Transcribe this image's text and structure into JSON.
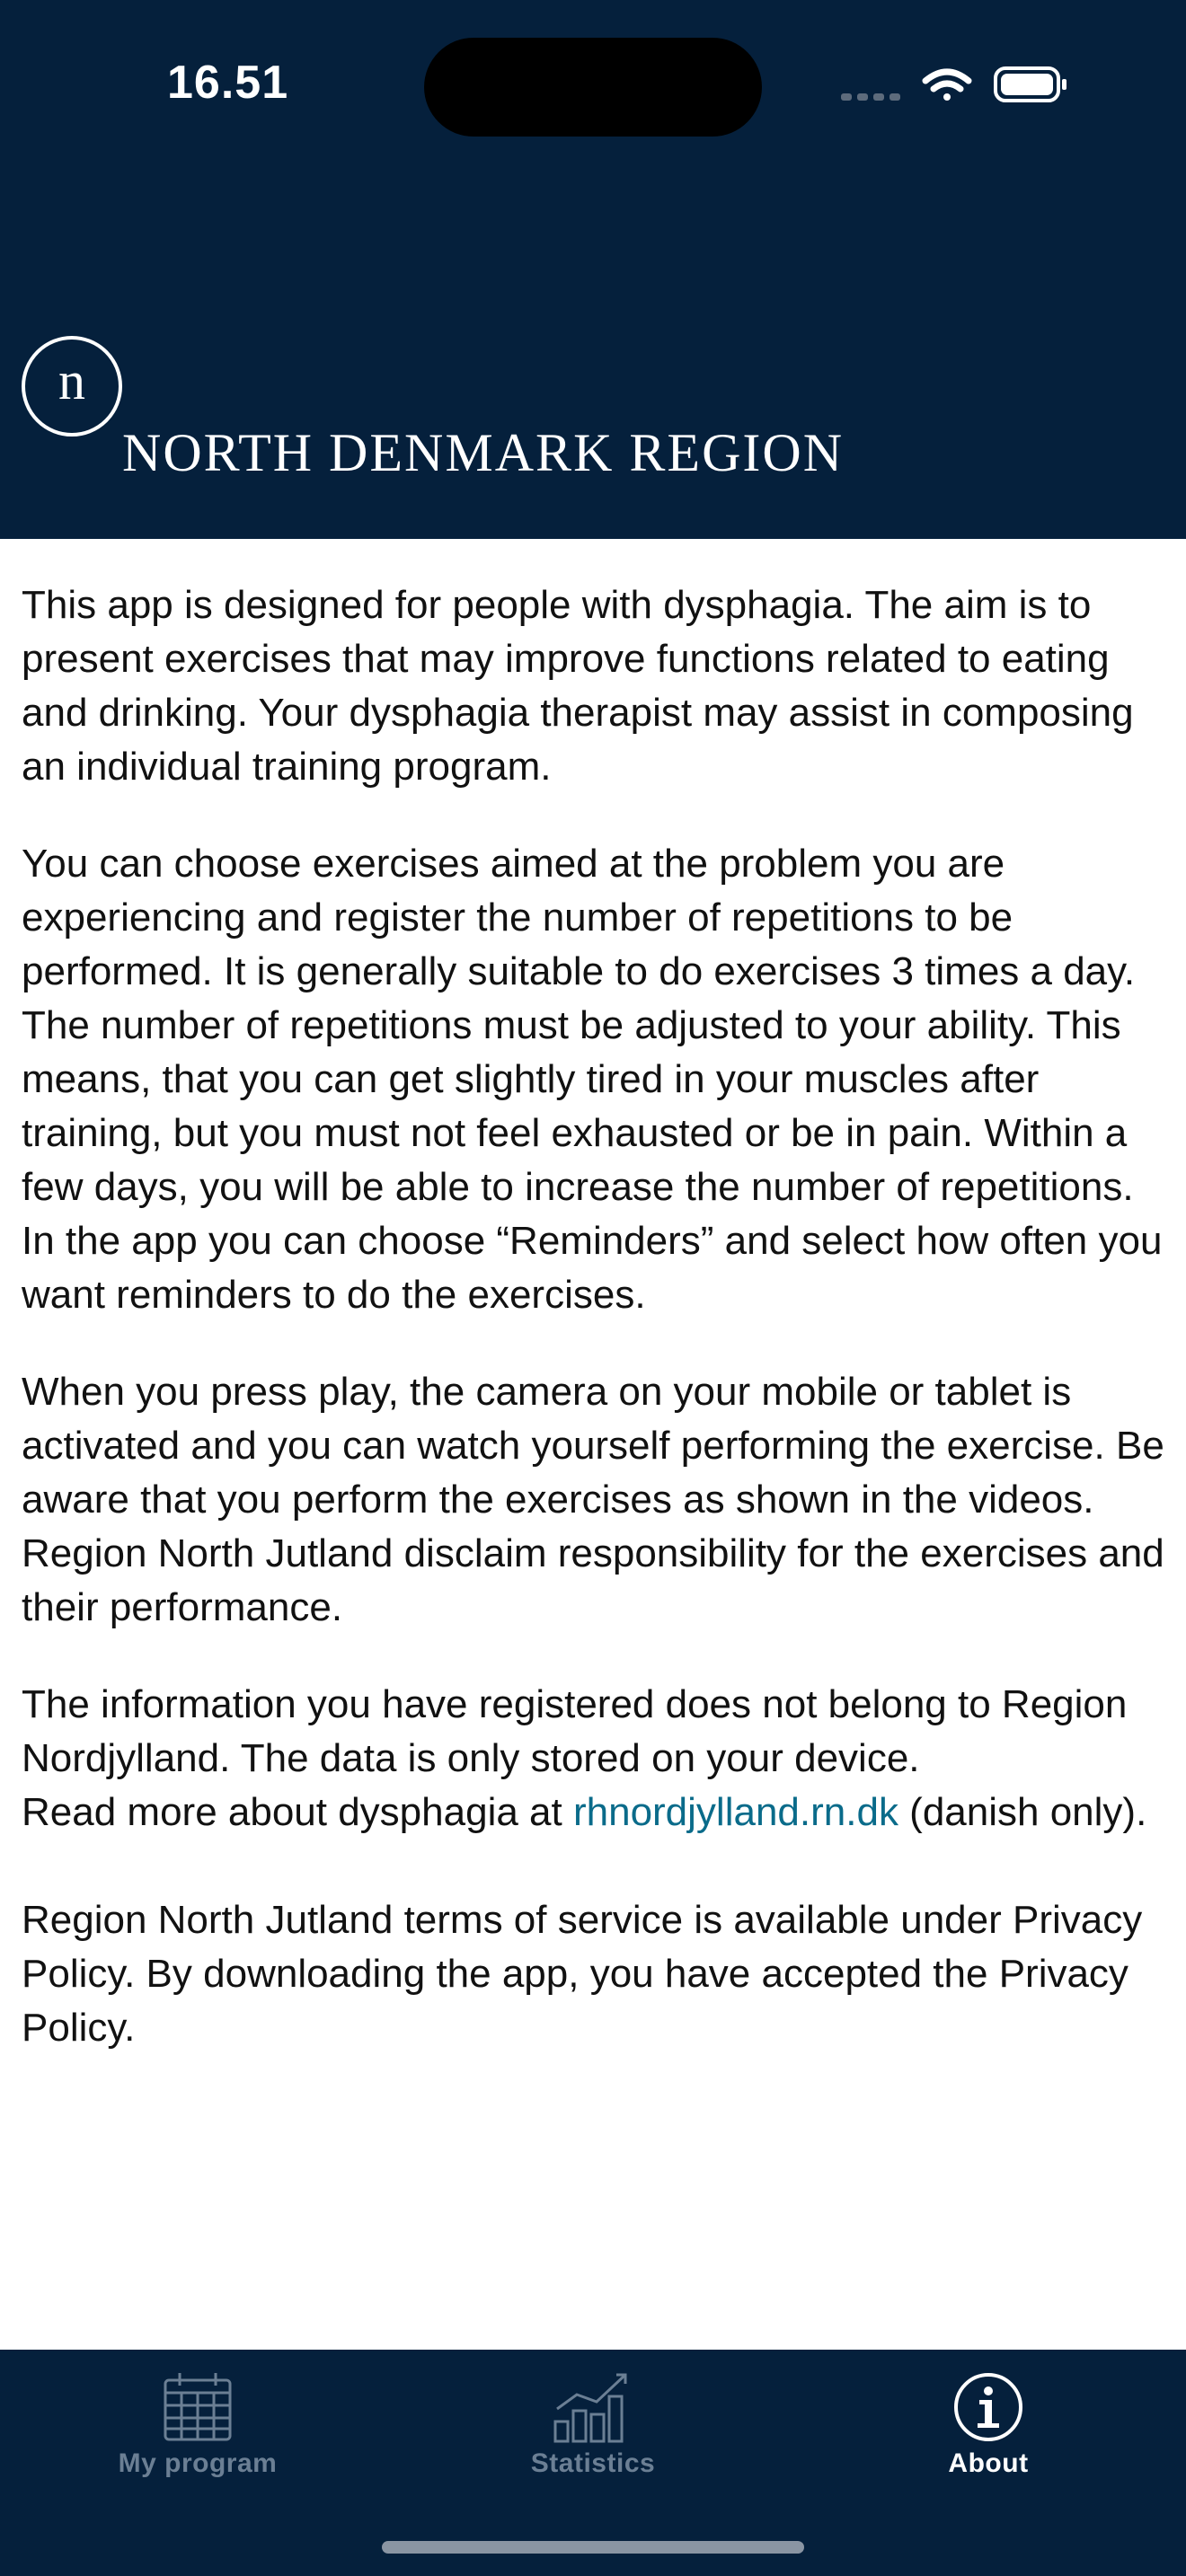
{
  "status_bar": {
    "time": "16.51",
    "signal_icon": "signal-dots-icon",
    "wifi_icon": "wifi-icon",
    "battery_icon": "battery-icon"
  },
  "header": {
    "logo_icon": "region-logo-icon",
    "brand_name": "NORTH DENMARK REGION"
  },
  "about": {
    "p1": "This app is designed for people with dysphagia. The aim is to present exercises that may improve functions related to eating and drinking. Your dysphagia therapist may assist in composing an individual training program.",
    "p2": "You can choose exercises aimed at the problem you are experiencing and register the number of repetitions to be performed. It is generally suitable to do exercises 3 times a day. The number of repetitions must be adjusted to your ability. This means, that you can get slightly tired in your muscles after training, but you must not feel exhausted or be in pain. Within a few days, you will be able to increase the number of repetitions. In the app you can choose “Reminders” and select how often you want reminders to do the exercises.",
    "p3": "When you press play, the camera on your mobile or tablet is activated and you can watch yourself performing the exercise. Be aware that you perform the exercises as shown in the videos. Region North Jutland disclaim responsibility for the exercises and their performance.",
    "p4": "The information you have registered does not belong to Region Nordjylland. The data is only stored on your device.",
    "read_more_prefix": "Read more about dysphagia at ",
    "read_more_link": "rhnordjylland.rn.dk",
    "read_more_suffix": " (danish only).",
    "p5": "Region North Jutland terms of service is available under Privacy Policy. By downloading the app, you have accepted the Privacy Policy."
  },
  "tabbar": {
    "tabs": [
      {
        "label": "My program",
        "icon": "calendar-icon",
        "active": false
      },
      {
        "label": "Statistics",
        "icon": "bar-chart-icon",
        "active": false
      },
      {
        "label": "About",
        "icon": "info-icon",
        "active": true
      }
    ]
  },
  "colors": {
    "navy": "#05203c",
    "link": "#0a6b8a",
    "inactive_tab": "#6b7f94"
  }
}
